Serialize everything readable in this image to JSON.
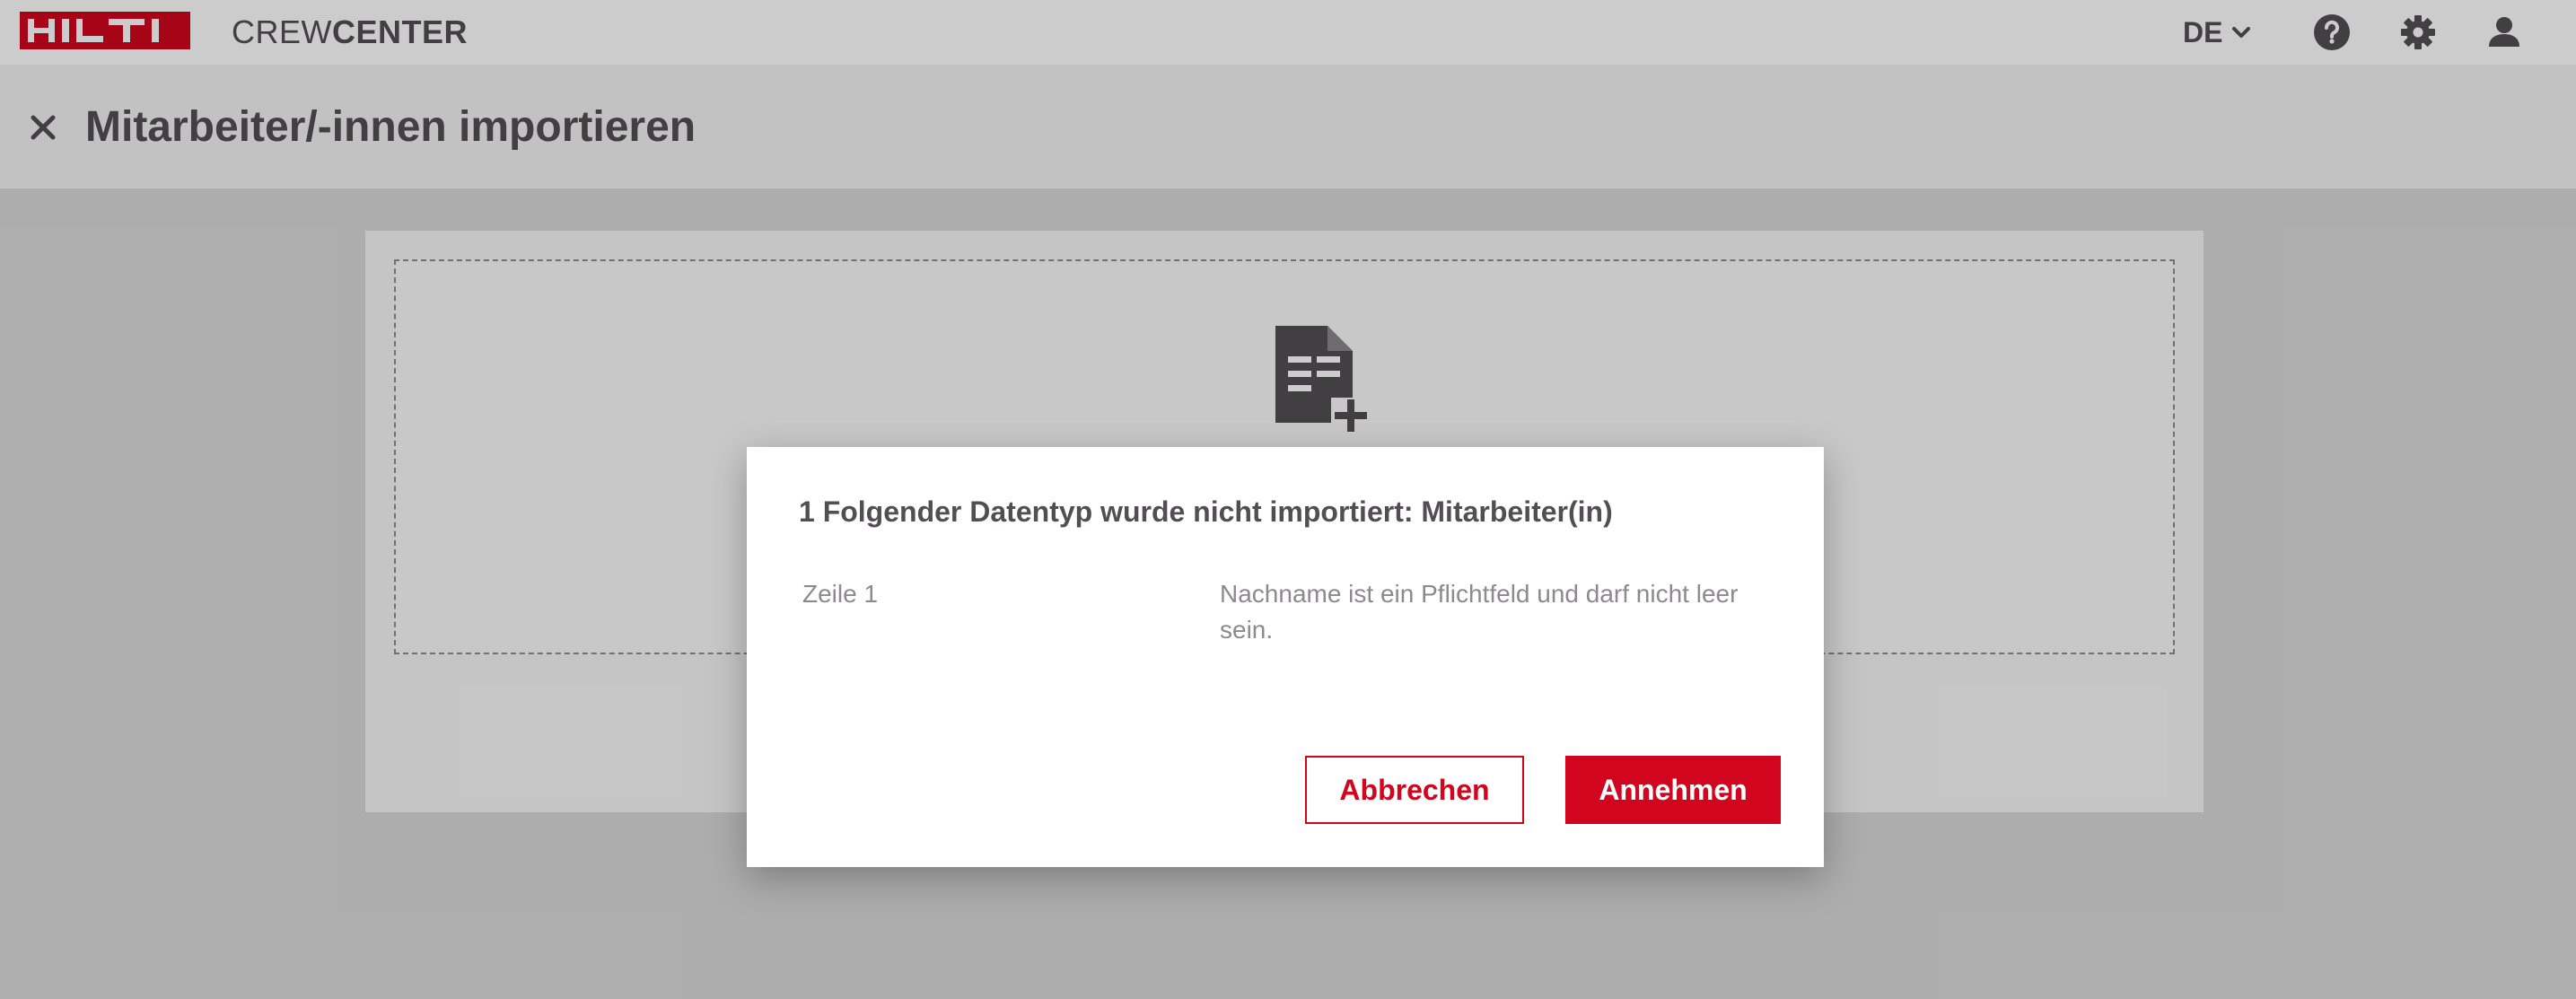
{
  "header": {
    "logo_text": "HILTI",
    "app_name_light": "CREW",
    "app_name_bold": "CENTER",
    "language": "DE",
    "icons": [
      "chevron-down-icon",
      "help-icon",
      "gear-icon",
      "user-icon"
    ]
  },
  "page": {
    "title": "Mitarbeiter/-innen importieren",
    "close_icon": "close-icon",
    "dropzone_icon": "file-add-icon"
  },
  "dialog": {
    "title": "1 Folgender Datentyp wurde nicht importiert: Mitarbeiter(in)",
    "errors": [
      {
        "row": "Zeile 1",
        "message": "Nachname ist ein Pflichtfeld und darf nicht leer sein."
      }
    ],
    "cancel_label": "Abbrechen",
    "accept_label": "Annehmen"
  },
  "colors": {
    "brand_red": "#d2051e",
    "text_dark": "#524f53",
    "text_muted": "#8c8a8c"
  }
}
